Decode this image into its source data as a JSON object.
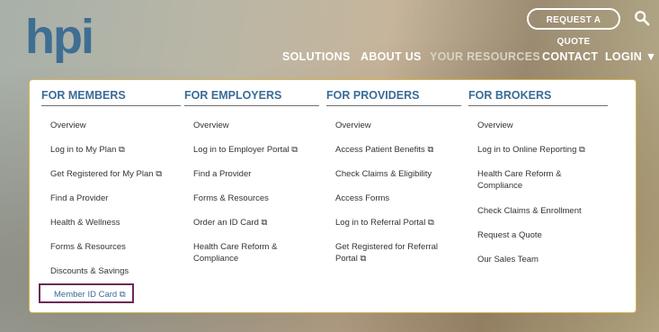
{
  "header": {
    "logo_text": "hpi",
    "request_quote": "REQUEST A QUOTE",
    "nav": [
      "SOLUTIONS",
      "ABOUT US",
      "YOUR RESOURCES",
      "CONTACT",
      "LOGIN ▼"
    ]
  },
  "menu": {
    "members": {
      "title": "FOR MEMBERS",
      "items": [
        "Overview",
        "Log in to My Plan ⧉",
        "Get Registered for My Plan ⧉",
        "Find a Provider",
        "Health & Wellness",
        "Forms & Resources",
        "Discounts & Savings",
        "Member ID Card ⧉"
      ]
    },
    "employers": {
      "title": "FOR EMPLOYERS",
      "items": [
        "Overview",
        "Log in to Employer Portal ⧉",
        "Find a Provider",
        "Forms & Resources",
        "Order an ID Card ⧉",
        "Health Care Reform &",
        "Compliance"
      ]
    },
    "providers": {
      "title": "FOR PROVIDERS",
      "items": [
        "Overview",
        "Access Patient Benefits ⧉",
        "Check Claims & Eligibility",
        "Access Forms",
        "Log in to Referral Portal ⧉",
        "Get Registered for Referral",
        "Portal ⧉"
      ]
    },
    "brokers": {
      "title": "FOR BROKERS",
      "items": [
        "Overview",
        "Log in to Online Reporting ⧉",
        "Health Care Reform &",
        "Compliance",
        "Check Claims & Enrollment",
        "Request a Quote",
        "Our Sales Team"
      ]
    }
  }
}
